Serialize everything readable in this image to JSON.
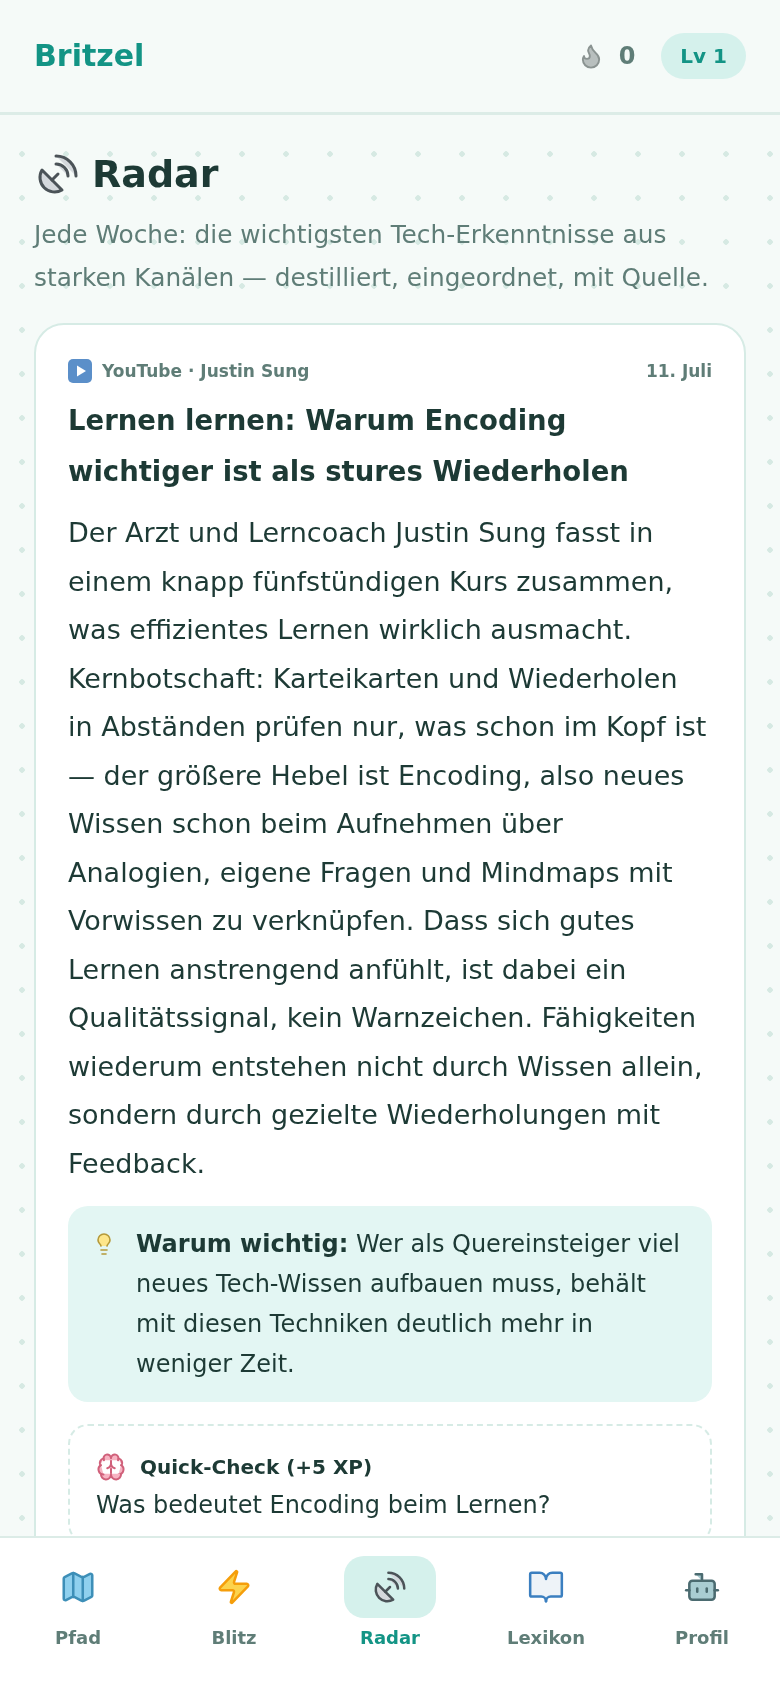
{
  "header": {
    "brand": "Britzel",
    "streak": "0",
    "level_badge": "Lv 1"
  },
  "page": {
    "title": "Radar",
    "subtitle": "Jede Woche: die wichtigsten Tech-Erkenntnisse aus starken Kanälen — destilliert, eingeordnet, mit Quelle."
  },
  "article": {
    "source": "YouTube · Justin Sung",
    "date": "11. Juli",
    "title": "Lernen lernen: Warum Encoding wichtiger ist als stures Wiederholen",
    "body": "Der Arzt und Lerncoach Justin Sung fasst in einem knapp fünfstündigen Kurs zusammen, was effizientes Lernen wirklich ausmacht. Kernbotschaft: Karteikarten und Wiederholen in Abständen prüfen nur, was schon im Kopf ist — der größere Hebel ist Encoding, also neues Wissen schon beim Aufnehmen über Analogien, eigene Fragen und Mindmaps mit Vorwissen zu verknüpfen. Dass sich gutes Lernen anstrengend anfühlt, ist dabei ein Qualitätssignal, kein Warnzeichen. Fähigkeiten wiederum entstehen nicht durch Wissen allein, sondern durch gezielte Wiederholungen mit Feedback.",
    "why": "**Warum wichtig:** Wer als Quereinsteiger viel neues Tech-Wissen aufbauen muss, behält mit diesen Techniken deutlich mehr in weniger Zeit.",
    "quick_check": {
      "title": "Quick-Check (+5 XP)",
      "question": "Was bedeutet Encoding beim Lernen?"
    }
  },
  "nav": [
    {
      "label": "Pfad",
      "selected": false
    },
    {
      "label": "Blitz",
      "selected": false
    },
    {
      "label": "Radar",
      "selected": true
    },
    {
      "label": "Lexikon",
      "selected": false
    },
    {
      "label": "Profil",
      "selected": false
    }
  ]
}
